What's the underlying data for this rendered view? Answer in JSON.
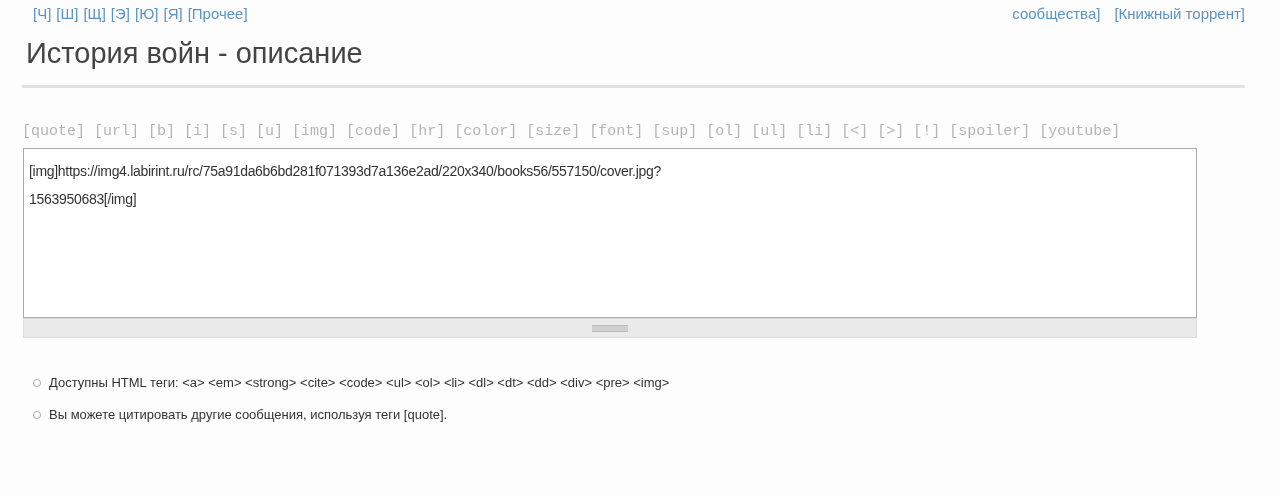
{
  "letter_links": [
    "[Ч]",
    "[Ш]",
    "[Щ]",
    "[Э]",
    "[Ю]",
    "[Я]",
    "[Прочее]"
  ],
  "top_links": [
    "сообщества]",
    "[Книжный торрент]"
  ],
  "title": "История войн - описание",
  "bbcode_buttons": [
    "[quote]",
    "[url]",
    "[b]",
    "[i]",
    "[s]",
    "[u]",
    "[img]",
    "[code]",
    "[hr]",
    "[color]",
    "[size]",
    "[font]",
    "[sup]",
    "[ol]",
    "[ul]",
    "[li]",
    "[<]",
    "[>]",
    "[!]",
    "[spoiler]",
    "[youtube]"
  ],
  "editor": {
    "lines": [
      "[img]https://img4.labirint.ru/rc/75a91da6b6bd281f071393d7a136e2ad/220x340/books56/557150/cover.jpg?",
      "1563950683[/img]"
    ]
  },
  "tips": [
    "Доступны HTML теги: <a> <em> <strong> <cite> <code> <ul> <ol> <li> <dl> <dt> <dd> <div> <pre> <img>",
    "Вы можете цитировать другие сообщения, используя теги [quote]."
  ]
}
